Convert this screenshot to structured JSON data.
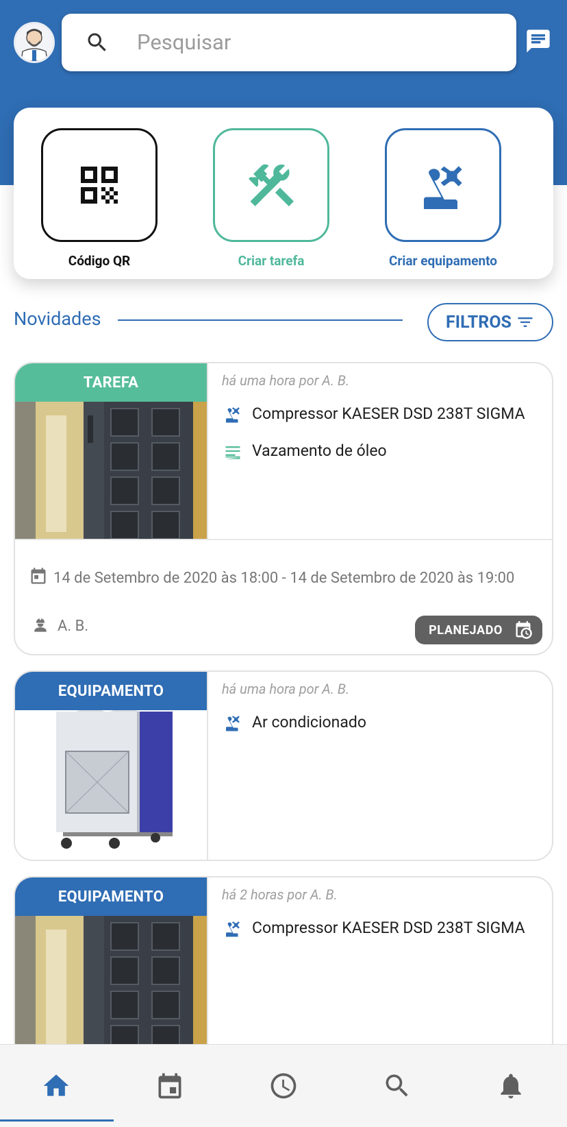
{
  "search": {
    "placeholder": "Pesquisar"
  },
  "actions": [
    {
      "label": "Código QR",
      "color": "#111111"
    },
    {
      "label": "Criar tarefa",
      "color": "#4fb89a"
    },
    {
      "label": "Criar equipamento",
      "color": "#2f6db4"
    }
  ],
  "feed": {
    "title": "Novidades",
    "filter_label": "FILTROS",
    "items": [
      {
        "type": "TAREFA",
        "type_color": "#56bd9a",
        "meta": "há uma hora por A. B.",
        "equipment": "Compressor KAESER DSD 238T SIGMA",
        "description": "Vazamento de óleo",
        "schedule": "14 de Setembro de 2020 às 18:00 - 14 de Setembro de 2020 às 19:00",
        "assignee": "A. B.",
        "status": "PLANEJADO"
      },
      {
        "type": "EQUIPAMENTO",
        "type_color": "#2f6db4",
        "meta": "há uma hora por A. B.",
        "equipment": "Ar condicionado"
      },
      {
        "type": "EQUIPAMENTO",
        "type_color": "#2f6db4",
        "meta": "há 2 horas por A. B.",
        "equipment": "Compressor KAESER DSD 238T SIGMA"
      }
    ]
  },
  "nav": [
    "home-icon",
    "calendar-icon",
    "clock-icon",
    "search-icon",
    "bell-icon"
  ],
  "colors": {
    "primary": "#2f6db4",
    "accent": "#56bd9a",
    "badge": "#616161"
  }
}
